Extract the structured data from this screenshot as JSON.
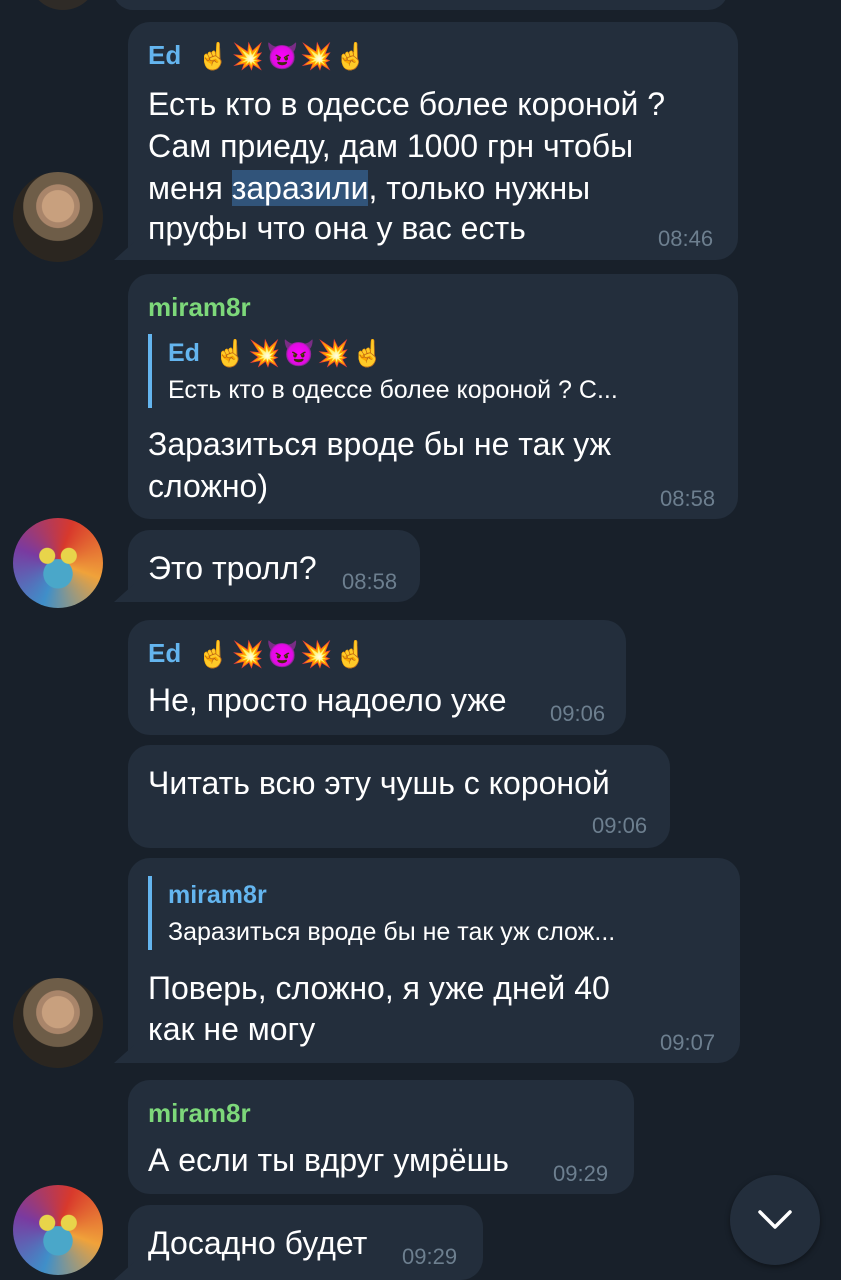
{
  "messages": [
    {
      "sender": "Ed",
      "text_line1": "Есть кто в одессе более короной ?",
      "text_line2": "Сам приеду, дам 1000 грн чтобы",
      "text_line3_before": "меня ",
      "text_line3_highlight": "заразили",
      "text_line3_after": ", только нужны",
      "text_line4": "пруфы что она у вас есть",
      "time": "08:46"
    },
    {
      "sender": "miram8r",
      "reply_sender": "Ed",
      "reply_text": "Есть кто в одессе более короной ?  С...",
      "text_line1": "Заразиться вроде бы не так уж",
      "text_line2": "сложно)",
      "time": "08:58"
    },
    {
      "text": "Это тролл?",
      "time": "08:58"
    },
    {
      "sender": "Ed",
      "text": "Не, просто надоело уже",
      "time": "09:06"
    },
    {
      "text": "Читать всю эту чушь с короной",
      "time": "09:06"
    },
    {
      "reply_sender": "miram8r",
      "reply_text": "Заразиться вроде бы не так уж слож...",
      "text_line1": "Поверь, сложно, я уже дней 40",
      "text_line2": "как не могу",
      "time": "09:07"
    },
    {
      "sender": "miram8r",
      "text": "А если ты вдруг умрёшь",
      "time": "09:29"
    },
    {
      "text": "Досадно будет",
      "time": "09:29"
    }
  ],
  "sender_emoji": {
    "finger": "☝",
    "burst": "💥",
    "devil": "😈"
  },
  "scroll_button": {
    "icon": "chevron-down-icon"
  },
  "colors": {
    "background": "#18202a",
    "bubble": "#232e3c",
    "sender_blue": "#64b5ef",
    "sender_green": "#7dd87a",
    "time": "#6d7f8f",
    "highlight": "#31547a"
  }
}
